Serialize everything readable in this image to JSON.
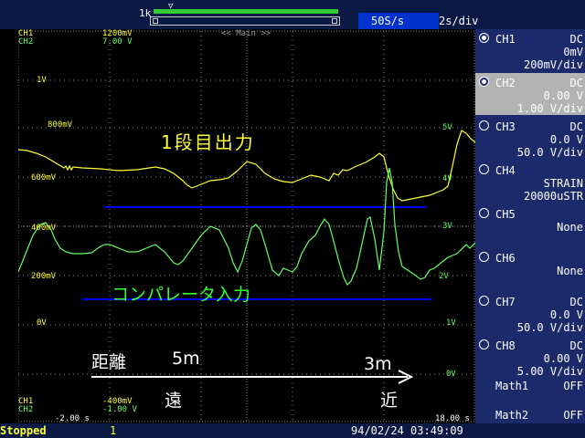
{
  "top": {
    "zoom_label": "1k",
    "sample_rate": "50S/s",
    "time_div": "2s/div"
  },
  "screen": {
    "header_ch1_name": "CH1",
    "header_ch1_value": "1200mV",
    "header_ch2_name": "CH2",
    "header_ch2_value": "7.00 V",
    "main_label": "<< Main >>",
    "footer_ch1_name": "CH1",
    "footer_ch1_value": "-400mV",
    "footer_ch2_name": "CH2",
    "footer_ch2_value": "-1.00 V",
    "time_start": "-2.00 s",
    "time_end": "18.00 s",
    "left_scale": [
      "1V",
      "800mV",
      "600mV",
      "400mV",
      "200mV",
      "0V"
    ],
    "right_scale": [
      "5V",
      "4V",
      "3V",
      "2V",
      "1V",
      "0V"
    ],
    "annot_output": "1段目出力",
    "annot_comparator": "コンパレータ入力",
    "annot_distance": "距離",
    "annot_5m": "5m",
    "annot_3m": "3m",
    "annot_far": "遠",
    "annot_near": "近"
  },
  "channels": [
    {
      "name": "CH1",
      "coupling": "DC",
      "line2": "0mV",
      "line3": "200mV/div",
      "selected": false,
      "on": true
    },
    {
      "name": "CH2",
      "coupling": "DC",
      "line2": "0.00 V",
      "line3": "1.00 V/div",
      "selected": true,
      "on": true
    },
    {
      "name": "CH3",
      "coupling": "DC",
      "line2": "0.0 V",
      "line3": "50.0 V/div",
      "selected": false,
      "on": false
    },
    {
      "name": "CH4",
      "coupling": "",
      "line2": "STRAIN",
      "line3": "20000uSTR",
      "selected": false,
      "on": false
    },
    {
      "name": "CH5",
      "coupling": "",
      "line2": "None",
      "line3": "",
      "selected": false,
      "on": false
    },
    {
      "name": "CH6",
      "coupling": "",
      "line2": "None",
      "line3": "",
      "selected": false,
      "on": false
    },
    {
      "name": "CH7",
      "coupling": "DC",
      "line2": "0.0 V",
      "line3": "50.0 V/div",
      "selected": false,
      "on": false
    },
    {
      "name": "CH8",
      "coupling": "DC",
      "line2": "0.00 V",
      "line3": "5.00 V/div",
      "selected": false,
      "on": false
    }
  ],
  "math": [
    {
      "name": "Math1",
      "value": "OFF"
    },
    {
      "name": "Math2",
      "value": "OFF"
    }
  ],
  "status": {
    "state": "Stopped",
    "count": "1",
    "datetime": "94/02/24 03:49:09"
  },
  "colors": {
    "ch1": "#ffff33",
    "ch2": "#66ff66",
    "panel": "#1a2a6a",
    "header": "#0a1a44",
    "marker_line": "#0000ff",
    "status_text": "#ffff33",
    "rate_box": "#0033cc"
  }
}
